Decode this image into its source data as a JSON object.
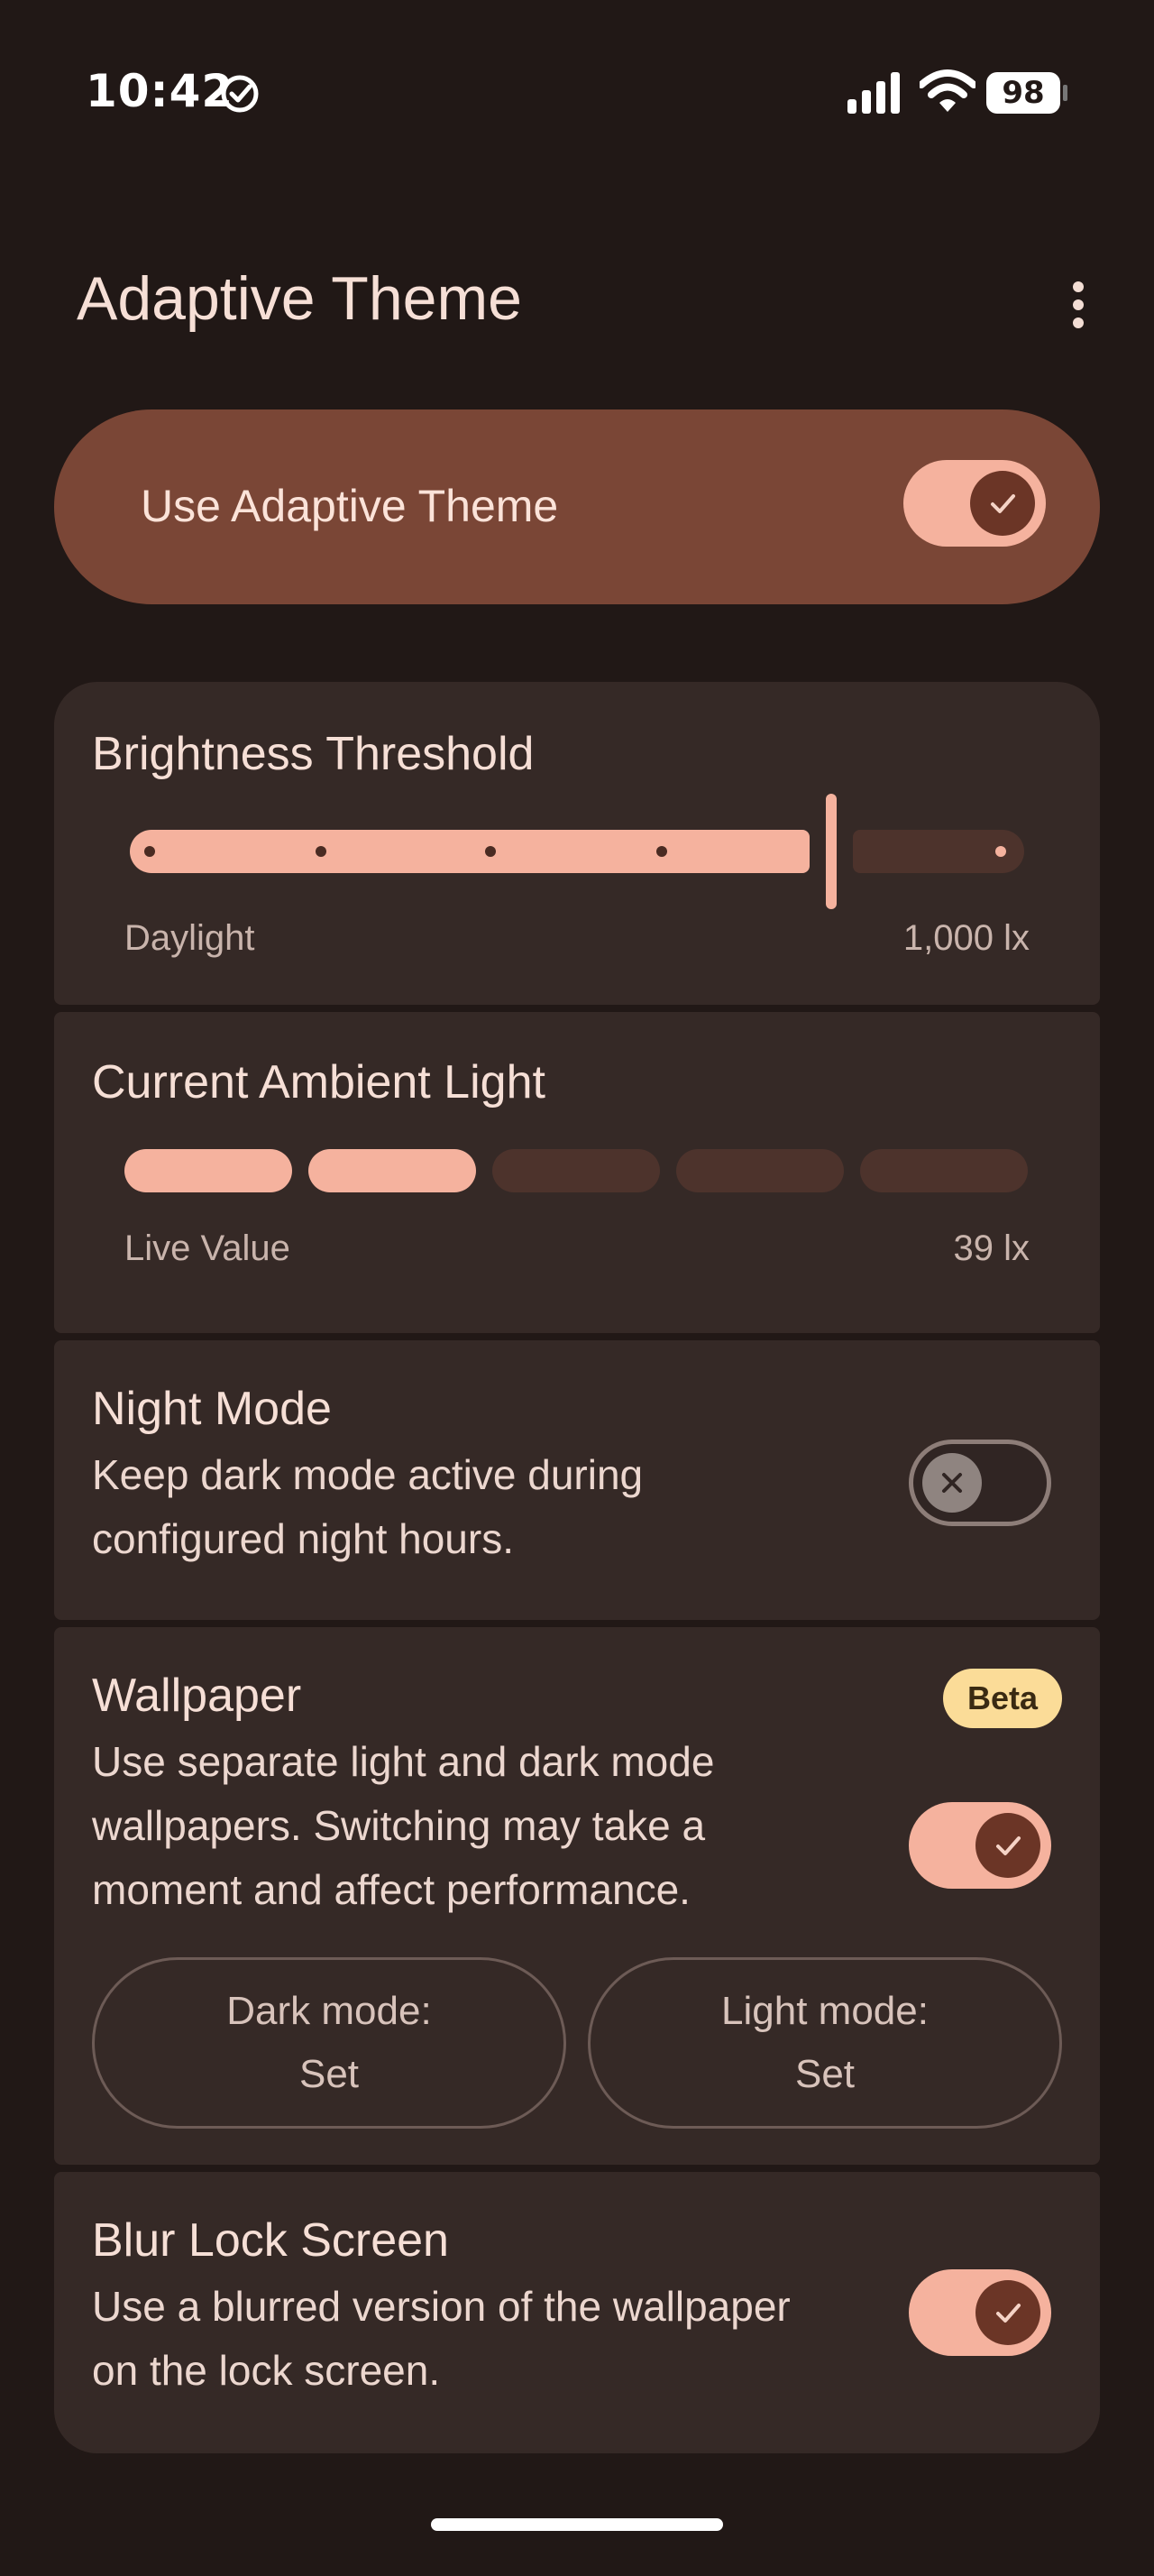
{
  "status_bar": {
    "time": "10:42",
    "battery": "98",
    "icons": [
      "check-circle-icon",
      "signal-icon",
      "wifi-icon",
      "battery-icon"
    ]
  },
  "header": {
    "title": "Adaptive Theme",
    "menu_icon": "more-vert-icon"
  },
  "master_toggle": {
    "label": "Use Adaptive Theme",
    "on": true
  },
  "brightness": {
    "title": "Brightness Threshold",
    "min_label": "Daylight",
    "value_label": "1,000 lx",
    "position_fraction": 0.8
  },
  "ambient": {
    "title": "Current Ambient Light",
    "min_label": "Live Value",
    "value_label": "39 lx",
    "segments_total": 5,
    "segments_filled": 2
  },
  "night_mode": {
    "title": "Night Mode",
    "description_line1": "Keep dark mode active during",
    "description_line2": "configured night hours.",
    "on": false
  },
  "wallpaper": {
    "title": "Wallpaper",
    "badge": "Beta",
    "description_line1": "Use separate light and dark mode",
    "description_line2": "wallpapers. Switching may take a",
    "description_line3": "moment and affect performance.",
    "on": true,
    "dark_button_line1": "Dark mode:",
    "dark_button_line2": "Set",
    "light_button_line1": "Light mode:",
    "light_button_line2": "Set"
  },
  "blur_lock": {
    "title": "Blur Lock Screen",
    "description_line1": "Use a blurred version of the wallpaper",
    "description_line2": "on the lock screen.",
    "on": true
  },
  "colors": {
    "background": "#211816",
    "accent": "#f5b29e",
    "master_card": "#7a4636",
    "card": "#352926",
    "badge": "#fbdc98"
  }
}
